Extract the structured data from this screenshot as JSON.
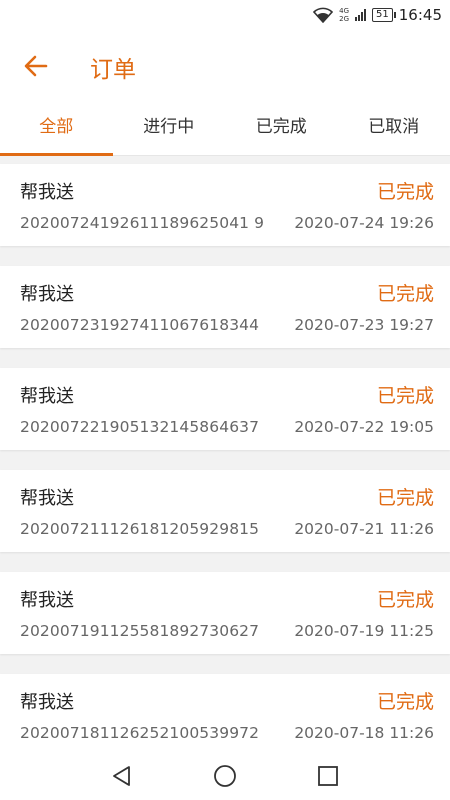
{
  "status_bar": {
    "net_top": "4G",
    "net_bottom": "2G",
    "battery": "51",
    "time": "16:45"
  },
  "header": {
    "title": "订单",
    "back_icon": "arrow-left-icon",
    "accent_color": "#e06b14"
  },
  "tabs": [
    {
      "label": "全部",
      "active": true
    },
    {
      "label": "进行中",
      "active": false
    },
    {
      "label": "已完成",
      "active": false
    },
    {
      "label": "已取消",
      "active": false
    }
  ],
  "orders": [
    {
      "title": "帮我送",
      "status": "已完成",
      "order_no": "20200724192611189625041 9",
      "time": "2020-07-24 19:26"
    },
    {
      "title": "帮我送",
      "status": "已完成",
      "order_no": "202007231927411067618344",
      "time": "2020-07-23 19:27"
    },
    {
      "title": "帮我送",
      "status": "已完成",
      "order_no": "202007221905132145864637",
      "time": "2020-07-22 19:05"
    },
    {
      "title": "帮我送",
      "status": "已完成",
      "order_no": "202007211126181205929815",
      "time": "2020-07-21 11:26"
    },
    {
      "title": "帮我送",
      "status": "已完成",
      "order_no": "202007191125581892730627",
      "time": "2020-07-19 11:25"
    },
    {
      "title": "帮我送",
      "status": "已完成",
      "order_no": "202007181126252100539972",
      "time": "2020-07-18 11:26"
    }
  ]
}
